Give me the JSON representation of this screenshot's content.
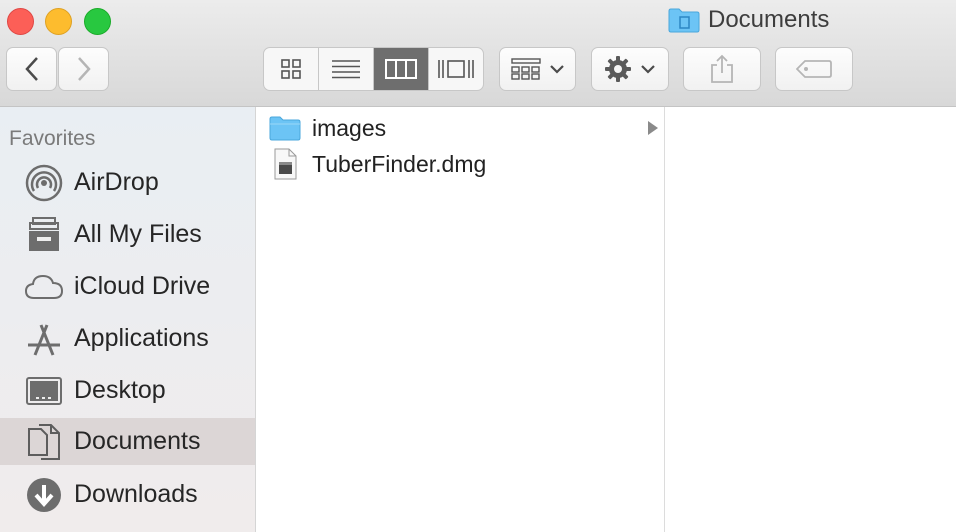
{
  "window": {
    "title": "Documents"
  },
  "toolbar": {
    "nav": {
      "back": "back",
      "forward": "forward"
    },
    "view_modes": [
      "icon-view",
      "list-view",
      "column-view",
      "cover-flow-view"
    ],
    "active_view": "column-view"
  },
  "sidebar": {
    "heading": "Favorites",
    "items": [
      {
        "label": "AirDrop",
        "icon": "airdrop-icon"
      },
      {
        "label": "All My Files",
        "icon": "all-my-files-icon"
      },
      {
        "label": "iCloud Drive",
        "icon": "cloud-icon"
      },
      {
        "label": "Applications",
        "icon": "applications-icon"
      },
      {
        "label": "Desktop",
        "icon": "desktop-icon"
      },
      {
        "label": "Documents",
        "icon": "documents-icon",
        "selected": true
      },
      {
        "label": "Downloads",
        "icon": "downloads-icon"
      }
    ]
  },
  "files": [
    {
      "name": "images",
      "type": "folder",
      "icon": "folder-icon"
    },
    {
      "name": "TuberFinder.dmg",
      "type": "disk-image",
      "icon": "disk-image-icon"
    }
  ],
  "colors": {
    "folder": "#6cc4f5",
    "selected_sidebar": "#dcd6d6",
    "active_segment": "#6e6e6e"
  }
}
